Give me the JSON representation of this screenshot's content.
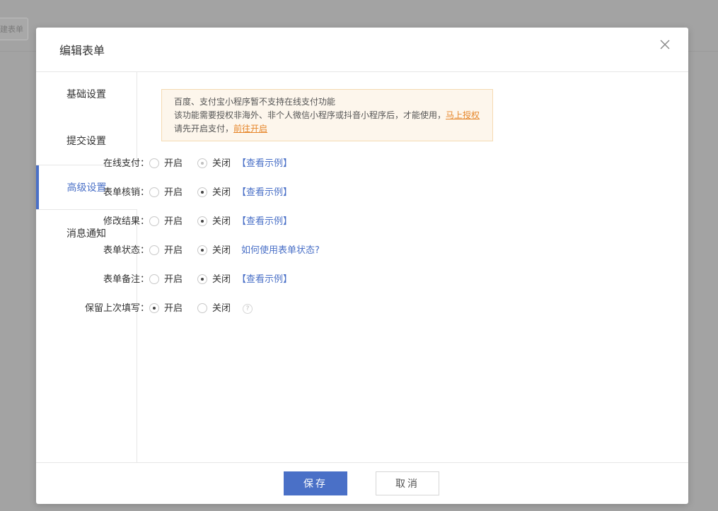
{
  "background": {
    "button_label": "建表单"
  },
  "modal": {
    "title": "编辑表单",
    "close_icon": "close-icon"
  },
  "sidebar": {
    "items": [
      {
        "label": "基础设置",
        "active": false
      },
      {
        "label": "提交设置",
        "active": false
      },
      {
        "label": "高级设置",
        "active": true
      },
      {
        "label": "消息通知",
        "active": false
      }
    ]
  },
  "notice": {
    "line1": "百度、支付宝小程序暂不支持在线支付功能",
    "line2_text": "该功能需要授权非海外、非个人微信小程序或抖音小程序后，才能使用，",
    "line2_link": "马上授权",
    "line3_text": "请先开启支付，",
    "line3_link": "前往开启"
  },
  "settings": [
    {
      "label": "在线支付：",
      "on": "开启",
      "off": "关闭",
      "selected": "off",
      "disabled": true,
      "link": "【查看示例】"
    },
    {
      "label": "表单核销：",
      "on": "开启",
      "off": "关闭",
      "selected": "off",
      "link": "【查看示例】"
    },
    {
      "label": "修改结果：",
      "on": "开启",
      "off": "关闭",
      "selected": "off",
      "link": "【查看示例】"
    },
    {
      "label": "表单状态：",
      "on": "开启",
      "off": "关闭",
      "selected": "off",
      "link": "如何使用表单状态?"
    },
    {
      "label": "表单备注：",
      "on": "开启",
      "off": "关闭",
      "selected": "off",
      "link": "【查看示例】"
    },
    {
      "label": "保留上次填写：",
      "on": "开启",
      "off": "关闭",
      "selected": "on",
      "help_icon": "question-icon",
      "help_text": "?"
    }
  ],
  "footer": {
    "save_label": "保存",
    "cancel_label": "取消"
  },
  "colors": {
    "accent": "#4a70c7",
    "warning_link": "#e6862a",
    "notice_bg": "#fdf6ec"
  }
}
